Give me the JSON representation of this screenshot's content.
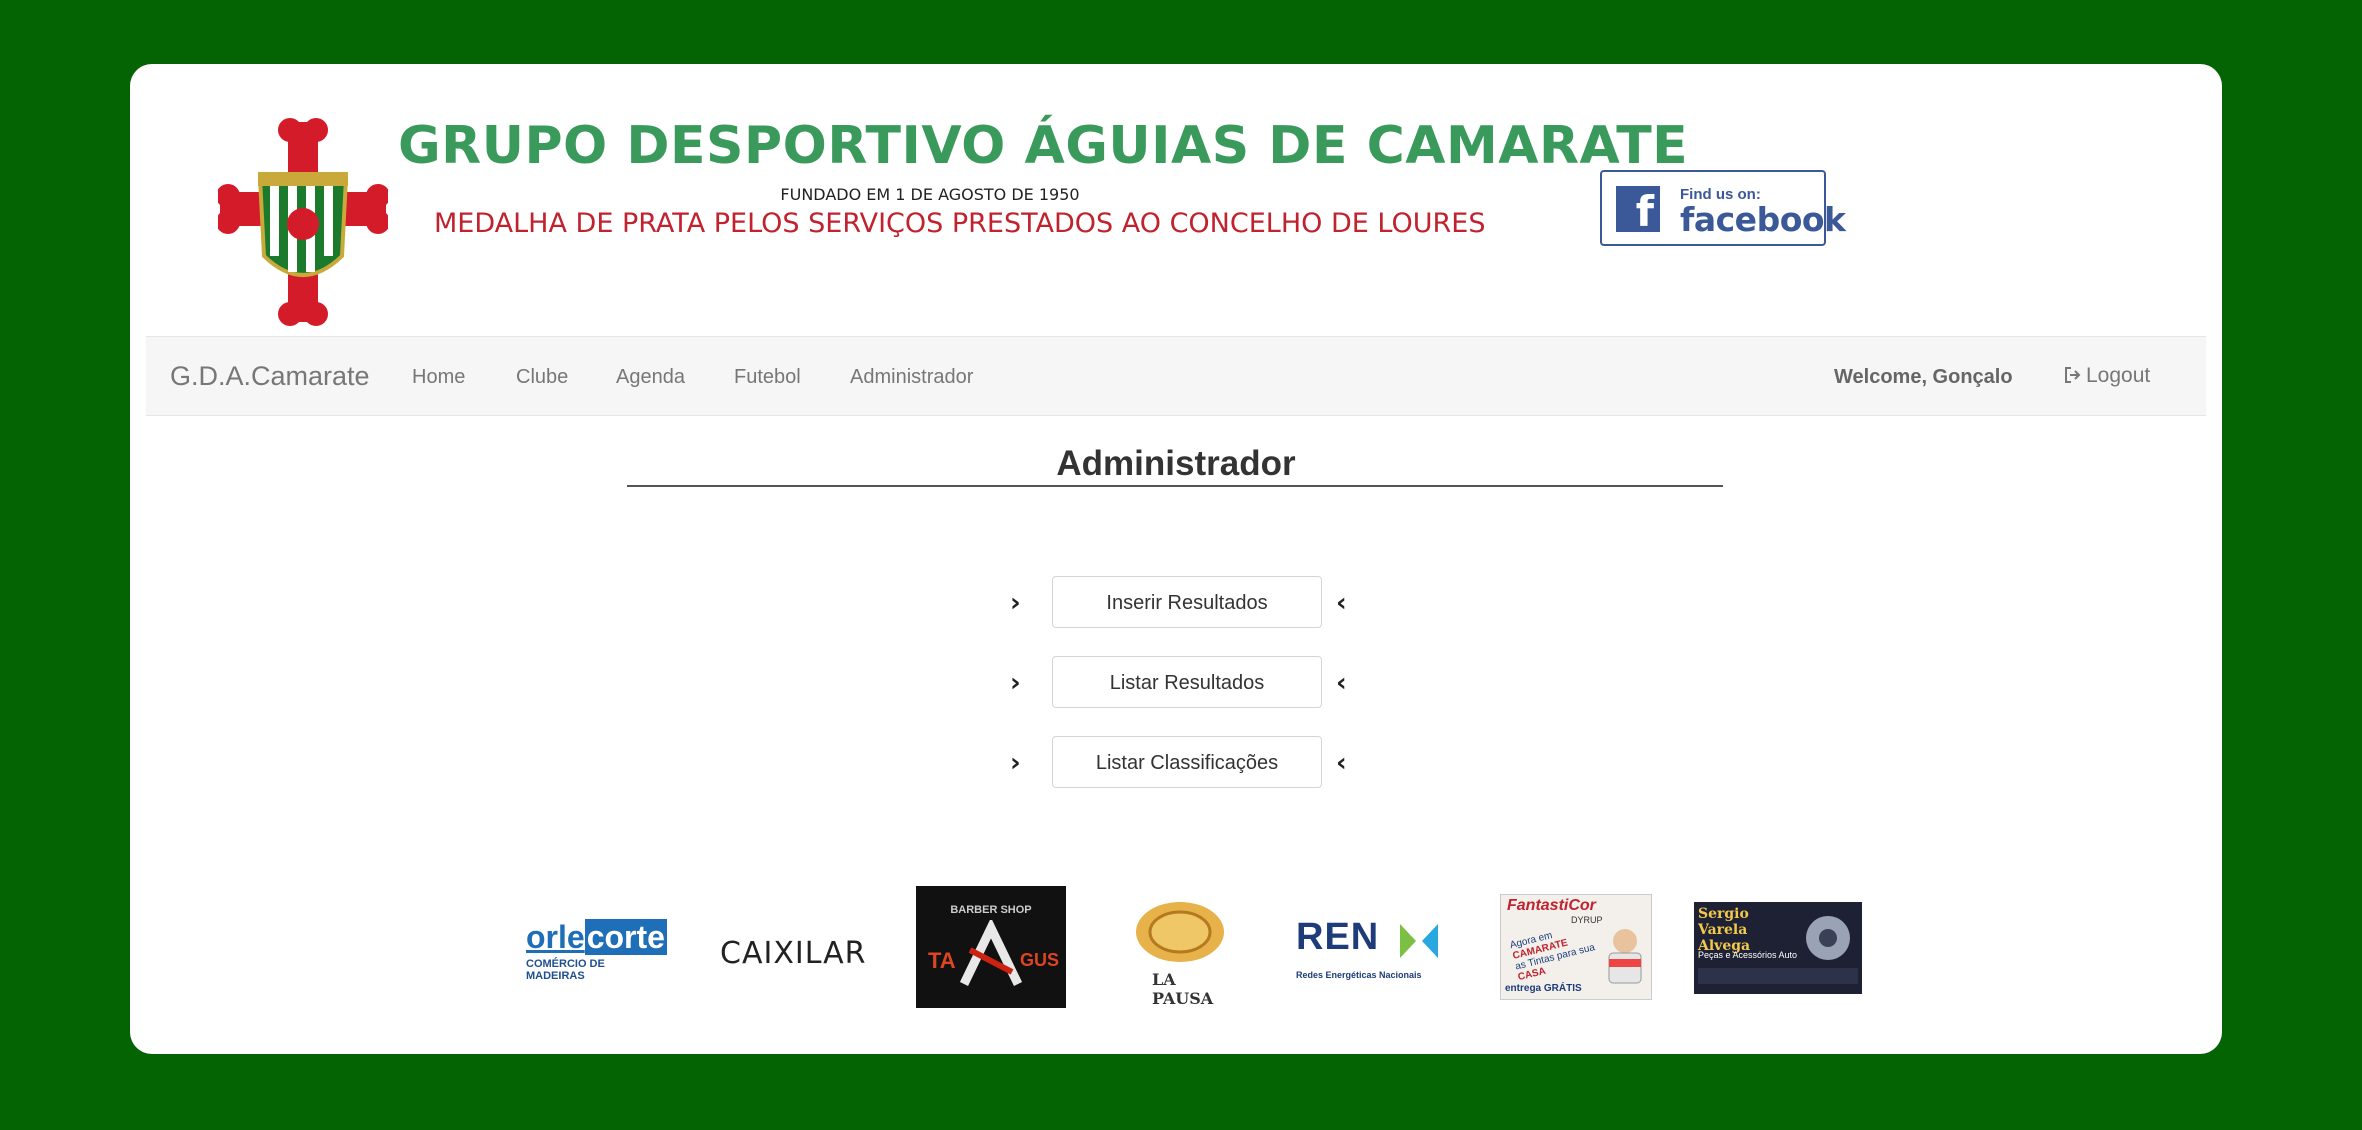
{
  "header": {
    "title": "GRUPO DESPORTIVO ÁGUIAS DE CAMARATE",
    "founded": "FUNDADO EM 1 DE AGOSTO DE 1950",
    "medal": "MEDALHA DE PRATA PELOS SERVIÇOS PRESTADOS AO CONCELHO DE LOURES",
    "facebook": {
      "small": "Find us on:",
      "big": "facebook",
      "icon_letter": "f"
    },
    "colors": {
      "title": "#3a9a5c",
      "medal": "#c0222e",
      "facebook": "#3b5998",
      "page_bg": "#046404"
    }
  },
  "navbar": {
    "brand": "G.D.A.Camarate",
    "links": [
      "Home",
      "Clube",
      "Agenda",
      "Futebol",
      "Administrador"
    ],
    "welcome": "Welcome, Gonçalo",
    "logout": "Logout"
  },
  "main": {
    "title": "Administrador",
    "actions": [
      {
        "label": "Inserir Resultados",
        "left_icon": "chevron-right-icon",
        "right_icon": "chevron-left-icon"
      },
      {
        "label": "Listar Resultados",
        "left_icon": "chevron-right-icon",
        "right_icon": "chevron-left-icon"
      },
      {
        "label": "Listar Classificações",
        "left_icon": "chevron-right-icon",
        "right_icon": "chevron-left-icon"
      }
    ],
    "chevron_right": "›",
    "chevron_left": "‹"
  },
  "sponsors": {
    "orlecorte": {
      "name_a": "orle",
      "name_b": "corte",
      "sub": "COMÉRCIO DE MADEIRAS"
    },
    "caixilar": {
      "name": "CAIXILAR"
    },
    "tagus": {
      "top": "BARBER SHOP",
      "left": "TA",
      "right": "GUS"
    },
    "lapausa": {
      "name": "LA PAUSA"
    },
    "ren": {
      "name": "REN",
      "sub": "Redes Energéticas Nacionais"
    },
    "fantasticor": {
      "name": "FantastiCor",
      "brand": "DYRUP",
      "line1": "Agora em",
      "line2": "CAMARATE",
      "line3": "as Tintas para sua",
      "line4": "CASA",
      "footer": "entrega GRÁTIS"
    },
    "sergio": {
      "name": "Sergio Varela Alvega",
      "sub": "Peças e Acessórios Auto"
    }
  }
}
